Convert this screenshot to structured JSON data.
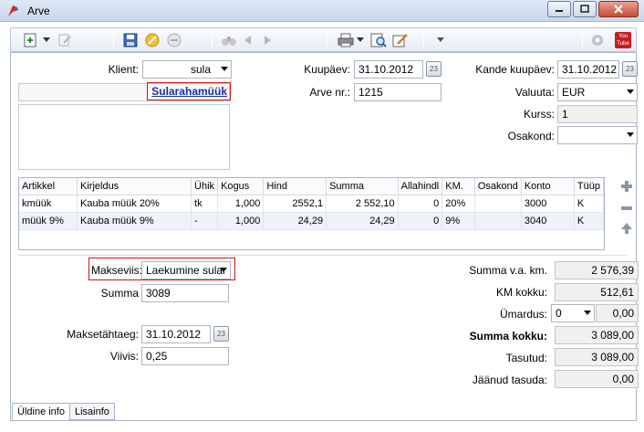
{
  "window": {
    "title": "Arve"
  },
  "toolbar": {
    "youtube_label": "You Tube"
  },
  "header": {
    "klient_label": "Klient:",
    "klient_value": "sula",
    "client_link": "Sularahamüük",
    "kuupaev_label": "Kuupäev:",
    "kuupaev_value": "31.10.2012",
    "arve_nr_label": "Arve nr.:",
    "arve_nr_value": "1215",
    "kande_kuupaev_label": "Kande kuupäev:",
    "kande_kuupaev_value": "31.10.2012",
    "valuuta_label": "Valuuta:",
    "valuuta_value": "EUR",
    "kurss_label": "Kurss:",
    "kurss_value": "1",
    "osakond_label": "Osakond:",
    "osakond_value": ""
  },
  "table": {
    "columns": [
      "Artikkel",
      "Kirjeldus",
      "Ühik",
      "Kogus",
      "Hind",
      "Summa",
      "Allahindl",
      "KM.",
      "Osakond",
      "Konto",
      "Tüüp"
    ],
    "rows": [
      [
        "kmüük",
        "Kauba müük  20%",
        "tk",
        "1,000",
        "2552,1",
        "2 552,10",
        "0",
        "20%",
        "",
        "3000",
        "K"
      ],
      [
        "müük 9%",
        "Kauba müük 9%",
        "-",
        "1,000",
        "24,29",
        "24,29",
        "0",
        "9%",
        "",
        "3040",
        "K"
      ]
    ]
  },
  "payment": {
    "makseviis_label": "Makseviis:",
    "makseviis_value": "Laekumine sular",
    "summa_label": "Summa",
    "summa_value": "3089",
    "maksetahtaeg_label": "Maksetähtaeg:",
    "maksetahtaeg_value": "31.10.2012",
    "viivis_label": "Viivis:",
    "viivis_value": "0,25"
  },
  "totals": {
    "summa_vak_label": "Summa v.a. km.",
    "summa_vak_value": "2 576,39",
    "km_kokku_label": "KM kokku:",
    "km_kokku_value": "512,61",
    "umardus_label": "Ümardus:",
    "umardus_select": "0",
    "umardus_value": "0,00",
    "summa_kokku_label": "Summa kokku:",
    "summa_kokku_value": "3 089,00",
    "tasutud_label": "Tasutud:",
    "tasutud_value": "3 089,00",
    "jaanud_label": "Jäänud tasuda:",
    "jaanud_value": "0,00"
  },
  "tabs": {
    "tab1": "Üldine info",
    "tab2": "Lisainfo"
  },
  "colors": {
    "titlebar": "#c7d6ea",
    "link": "#1a2fa6",
    "highlight_border": "#d21515",
    "alt_row": "#eef3f9"
  }
}
